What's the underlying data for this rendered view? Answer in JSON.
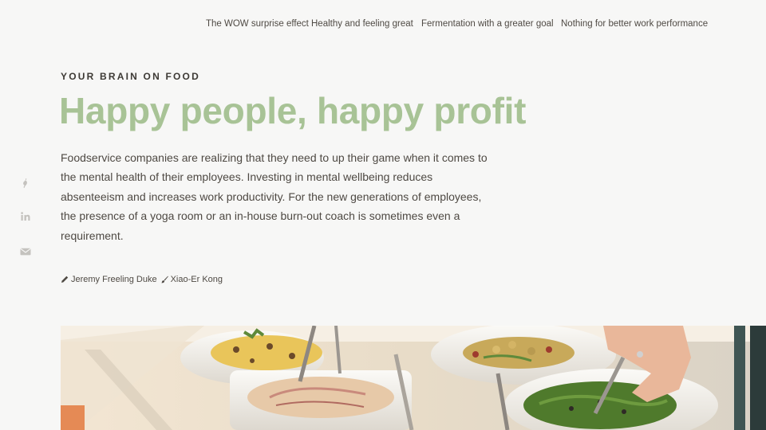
{
  "nav": {
    "items": [
      {
        "label": "The WOW surprise effect"
      },
      {
        "label": "Healthy and feeling great"
      },
      {
        "label": "Fermentation with a greater goal"
      },
      {
        "label": "Nothing for better work performance"
      }
    ]
  },
  "article": {
    "kicker": "YOUR BRAIN ON FOOD",
    "title": "Happy people, happy profit",
    "lede": "Foodservice companies are realizing that they need to up their game when it comes to the mental health of their employees. Investing in mental wellbeing reduces absenteeism and increases work productivity. For the new generations of employees, the presence of a yoga room or an in-house burn-out coach is sometimes even a requirement.",
    "authors": [
      {
        "name": "Jeremy Freeling Duke",
        "icon": "pen-icon"
      },
      {
        "name": "Xiao-Er Kong",
        "icon": "brush-icon"
      }
    ]
  },
  "social": {
    "icons": [
      "facebook-icon",
      "linkedin-icon",
      "mail-icon"
    ]
  },
  "colors": {
    "background": "#f7f7f6",
    "accent": "#a8c396",
    "text": "#4e4943"
  }
}
